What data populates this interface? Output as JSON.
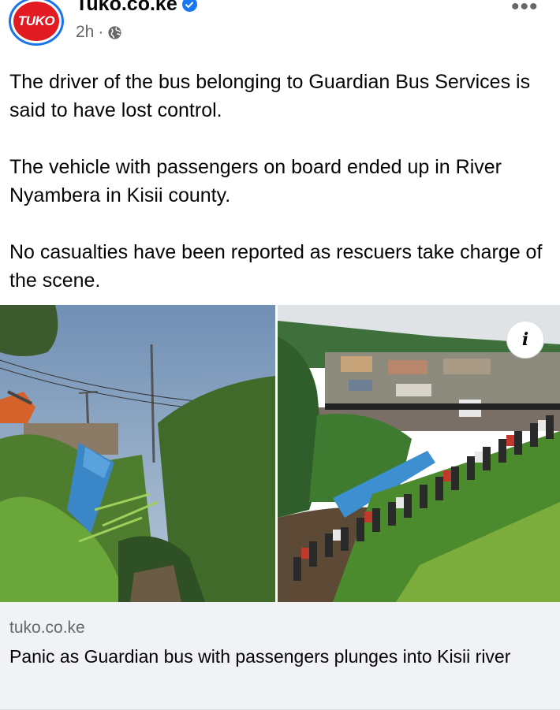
{
  "header": {
    "avatar_logo": "TUKO",
    "page_name": "Tuko.co.ke",
    "time": "2h",
    "separator": "·",
    "more_icon": "more-horizontal-icon",
    "verified_icon": "verified-badge-icon",
    "privacy_icon": "globe-icon"
  },
  "post": {
    "paragraphs": [
      "The driver of the bus belonging to Guardian Bus Services is said to have lost control.",
      "The vehicle with passengers on board ended up in River Nyambera in Kisii county.",
      "No casualties have been reported as rescuers take charge of the scene."
    ]
  },
  "media": {
    "info_label": "i",
    "info_icon": "info-icon"
  },
  "link_card": {
    "domain": "tuko.co.ke",
    "title": "Panic as Guardian bus with passengers plunges into Kisii river"
  },
  "colors": {
    "brand_red": "#e21b23",
    "verified_blue": "#1877f2",
    "card_background": "#f0f2f5",
    "secondary_text": "#65676b"
  }
}
